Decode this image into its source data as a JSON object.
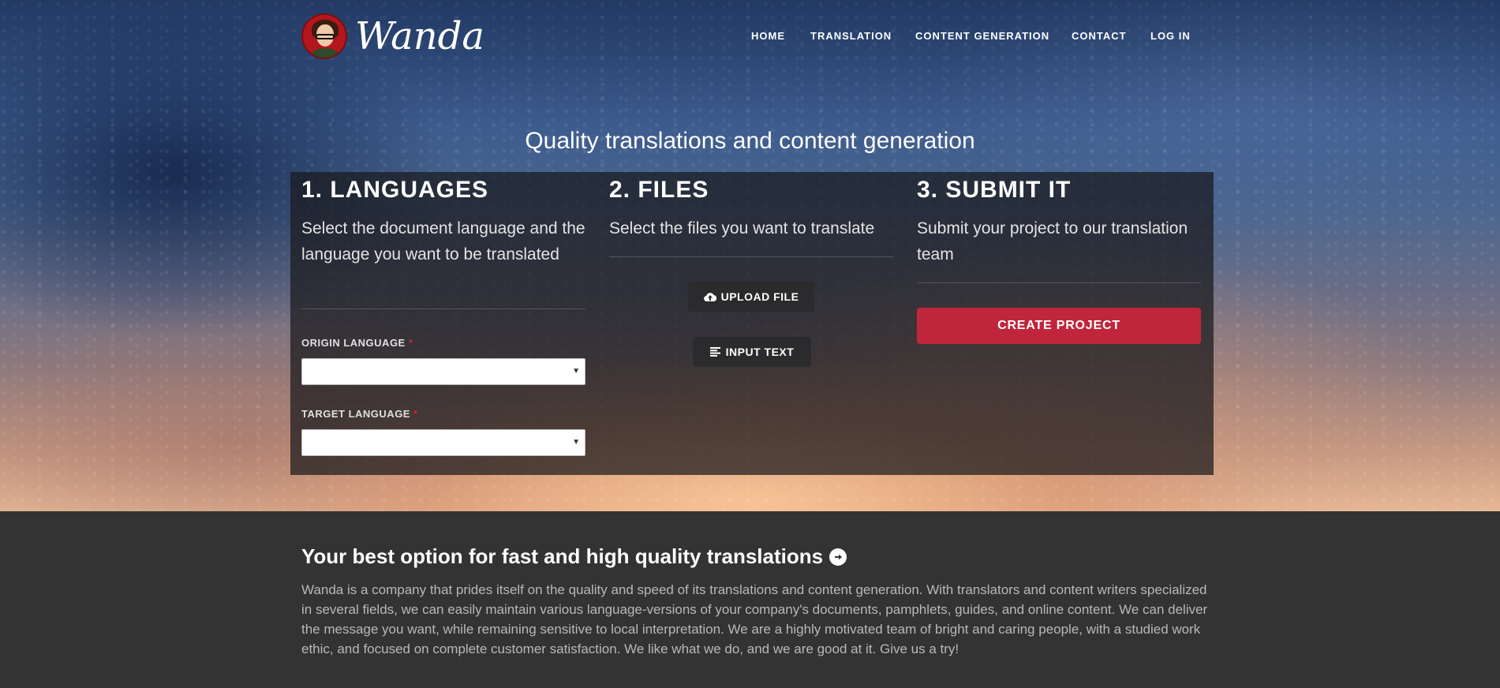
{
  "brand": {
    "name": "Wanda"
  },
  "nav": {
    "items": [
      "HOME",
      "TRANSLATION",
      "CONTENT GENERATION",
      "CONTACT",
      "LOG IN"
    ]
  },
  "hero": {
    "tagline": "Quality translations and content generation"
  },
  "steps": {
    "languages": {
      "title": "1. LANGUAGES",
      "description": "Select the document language and the language you want to be translated",
      "origin_label": "ORIGIN LANGUAGE",
      "origin_required_mark": "*",
      "origin_value": "",
      "target_label": "TARGET LANGUAGE",
      "target_required_mark": "*",
      "target_value": ""
    },
    "files": {
      "title": "2. FILES",
      "description": "Select the files you want to translate",
      "upload_label": "UPLOAD FILE",
      "input_text_label": "INPUT TEXT"
    },
    "submit": {
      "title": "3. SUBMIT IT",
      "description": "Submit your project to our translation team",
      "create_label": "CREATE PROJECT"
    }
  },
  "about": {
    "heading": "Your best option for fast and high quality translations",
    "body": "Wanda is a company that prides itself on the quality and speed of its translations and content generation. With translators and content writers specialized in several fields, we can easily maintain various language-versions of your company's documents, pamphlets, guides, and online content. We can deliver the message you want, while remaining sensitive to local interpretation. We are a highly motivated team of bright and caring people, with a studied work ethic, and focused on complete customer satisfaction. We like what we do, and we are good at it. Give us a try!"
  },
  "colors": {
    "accent": "#c0263b",
    "footer_bg": "#333333",
    "panel_bg": "rgba(25,25,28,0.72)"
  },
  "icons": {
    "upload": "cloud-upload-icon",
    "input_text": "align-left-icon",
    "about_heading": "arrow-circle-right-icon"
  }
}
